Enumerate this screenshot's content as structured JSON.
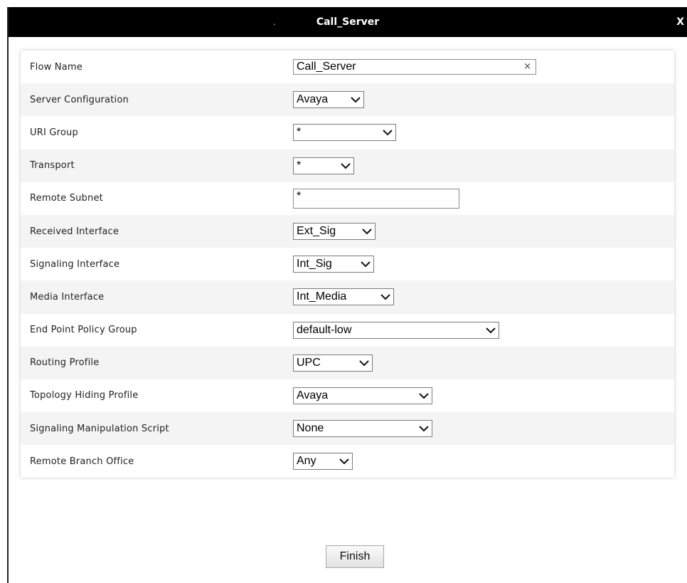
{
  "dialog": {
    "title": "Call_Server",
    "title_marker": ".",
    "close_label": "X"
  },
  "form": {
    "rows": [
      {
        "label": "Flow Name",
        "type": "text",
        "value": "Call_Server",
        "clear": "×"
      },
      {
        "label": "Server Configuration",
        "type": "select",
        "value": "Avaya"
      },
      {
        "label": "URI Group",
        "type": "select",
        "value": "*"
      },
      {
        "label": "Transport",
        "type": "select",
        "value": "*"
      },
      {
        "label": "Remote Subnet",
        "type": "text",
        "value": "*"
      },
      {
        "label": "Received Interface",
        "type": "select",
        "value": "Ext_Sig"
      },
      {
        "label": "Signaling Interface",
        "type": "select",
        "value": "Int_Sig"
      },
      {
        "label": "Media Interface",
        "type": "select",
        "value": "Int_Media"
      },
      {
        "label": "End Point Policy Group",
        "type": "select",
        "value": "default-low"
      },
      {
        "label": "Routing Profile",
        "type": "select",
        "value": "UPC"
      },
      {
        "label": "Topology Hiding Profile",
        "type": "select",
        "value": "Avaya"
      },
      {
        "label": "Signaling Manipulation Script",
        "type": "select",
        "value": "None"
      },
      {
        "label": "Remote Branch Office",
        "type": "select",
        "value": "Any"
      }
    ]
  },
  "footer": {
    "finish_label": "Finish"
  },
  "icons": {
    "dropdown": "chevron-down-icon",
    "clear": "clear-icon",
    "close": "close-icon"
  }
}
